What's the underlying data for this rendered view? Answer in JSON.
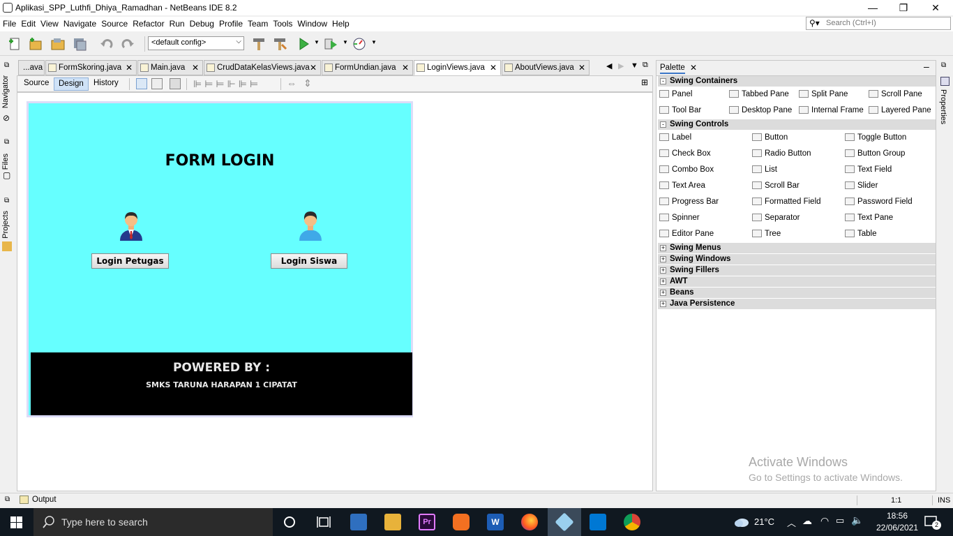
{
  "window": {
    "title": "Aplikasi_SPP_Luthfi_Dhiya_Ramadhan - NetBeans IDE 8.2",
    "minimize": "—",
    "maximize": "❐",
    "close": "✕"
  },
  "menubar": [
    "File",
    "Edit",
    "View",
    "Navigate",
    "Source",
    "Refactor",
    "Run",
    "Debug",
    "Profile",
    "Team",
    "Tools",
    "Window",
    "Help"
  ],
  "search": {
    "placeholder": "Search (Ctrl+I)"
  },
  "toolbar": {
    "config_value": "<default config>"
  },
  "left_strip": {
    "navigator": "Navigator",
    "files": "Files",
    "projects": "Projects"
  },
  "editor_tabs": [
    {
      "label": "...ava"
    },
    {
      "label": "FormSkoring.java"
    },
    {
      "label": "Main.java"
    },
    {
      "label": "CrudDataKelasViews.java"
    },
    {
      "label": "FormUndian.java"
    },
    {
      "label": "LoginViews.java",
      "active": true
    },
    {
      "label": "AboutViews.java"
    }
  ],
  "design_bar": {
    "source": "Source",
    "design": "Design",
    "history": "History"
  },
  "form": {
    "title": "FORM LOGIN",
    "btn_petugas": "Login Petugas",
    "btn_siswa": "Login Siswa",
    "footer_title": "POWERED BY :",
    "footer_sub": "SMKS TARUNA HARAPAN 1 CIPATAT",
    "bg_color": "#66ffff"
  },
  "palette": {
    "title": "Palette",
    "categories": {
      "swing_containers": "Swing Containers",
      "swing_controls": "Swing Controls",
      "swing_menus": "Swing Menus",
      "swing_windows": "Swing Windows",
      "swing_fillers": "Swing Fillers",
      "awt": "AWT",
      "beans": "Beans",
      "java_persistence": "Java Persistence"
    },
    "containers": [
      "Panel",
      "Tabbed Pane",
      "Split Pane",
      "Scroll Pane",
      "Tool Bar",
      "Desktop Pane",
      "Internal Frame",
      "Layered Pane"
    ],
    "controls": [
      "Label",
      "Button",
      "Toggle Button",
      "Check Box",
      "Radio Button",
      "Button Group",
      "Combo Box",
      "List",
      "Text Field",
      "Text Area",
      "Scroll Bar",
      "Slider",
      "Progress Bar",
      "Formatted Field",
      "Password Field",
      "Spinner",
      "Separator",
      "Text Pane",
      "Editor Pane",
      "Tree",
      "Table"
    ]
  },
  "right_strip": {
    "properties": "Properties"
  },
  "watermark": {
    "line1": "Activate Windows",
    "line2": "Go to Settings to activate Windows."
  },
  "status": {
    "output": "Output",
    "position": "1:1",
    "mode": "INS"
  },
  "taskbar": {
    "search_placeholder": "Type here to search",
    "weather": "21°C",
    "time": "18:56",
    "date": "22/06/2021",
    "notifications": "2"
  }
}
